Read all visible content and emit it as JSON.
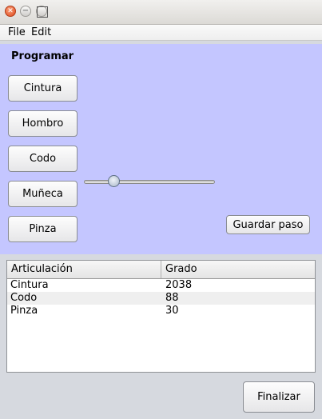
{
  "window": {
    "controls": {
      "close_icon": "✕",
      "minimize_icon": "−"
    }
  },
  "menu": {
    "items": [
      "File",
      "Edit"
    ]
  },
  "panel": {
    "title": "Programar",
    "background": "#c4c6ff",
    "joint_buttons": [
      "Cintura",
      "Hombro",
      "Codo",
      "Muñeca",
      "Pinza"
    ],
    "save_button": "Guardar paso"
  },
  "table": {
    "columns": [
      "Articulación",
      "Grado"
    ],
    "rows": [
      [
        "Cintura",
        "2038"
      ],
      [
        "Codo",
        "88"
      ],
      [
        "Pinza",
        "30"
      ]
    ]
  },
  "footer": {
    "finish_button": "Finalizar"
  }
}
